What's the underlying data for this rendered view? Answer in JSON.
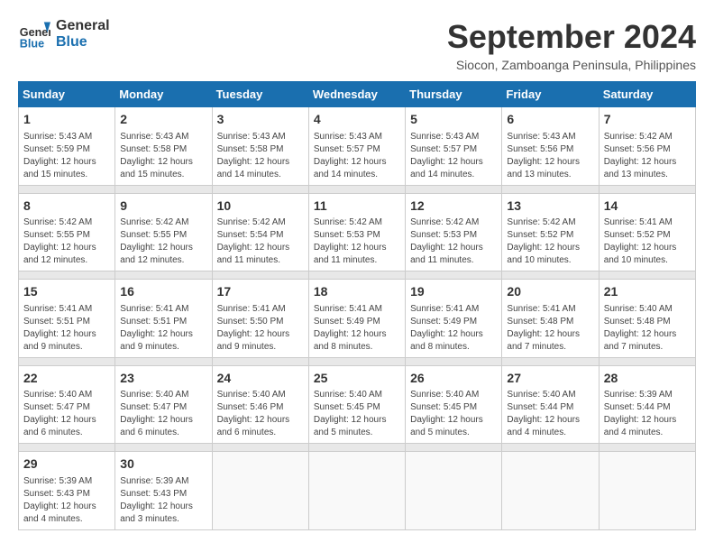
{
  "logo": {
    "text_general": "General",
    "text_blue": "Blue"
  },
  "title": {
    "month_year": "September 2024",
    "location": "Siocon, Zamboanga Peninsula, Philippines"
  },
  "weekdays": [
    "Sunday",
    "Monday",
    "Tuesday",
    "Wednesday",
    "Thursday",
    "Friday",
    "Saturday"
  ],
  "weeks": [
    [
      {
        "day": "1",
        "sunrise": "5:43 AM",
        "sunset": "5:59 PM",
        "daylight": "12 hours and 15 minutes."
      },
      {
        "day": "2",
        "sunrise": "5:43 AM",
        "sunset": "5:58 PM",
        "daylight": "12 hours and 15 minutes."
      },
      {
        "day": "3",
        "sunrise": "5:43 AM",
        "sunset": "5:58 PM",
        "daylight": "12 hours and 14 minutes."
      },
      {
        "day": "4",
        "sunrise": "5:43 AM",
        "sunset": "5:57 PM",
        "daylight": "12 hours and 14 minutes."
      },
      {
        "day": "5",
        "sunrise": "5:43 AM",
        "sunset": "5:57 PM",
        "daylight": "12 hours and 14 minutes."
      },
      {
        "day": "6",
        "sunrise": "5:43 AM",
        "sunset": "5:56 PM",
        "daylight": "12 hours and 13 minutes."
      },
      {
        "day": "7",
        "sunrise": "5:42 AM",
        "sunset": "5:56 PM",
        "daylight": "12 hours and 13 minutes."
      }
    ],
    [
      {
        "day": "8",
        "sunrise": "5:42 AM",
        "sunset": "5:55 PM",
        "daylight": "12 hours and 12 minutes."
      },
      {
        "day": "9",
        "sunrise": "5:42 AM",
        "sunset": "5:55 PM",
        "daylight": "12 hours and 12 minutes."
      },
      {
        "day": "10",
        "sunrise": "5:42 AM",
        "sunset": "5:54 PM",
        "daylight": "12 hours and 11 minutes."
      },
      {
        "day": "11",
        "sunrise": "5:42 AM",
        "sunset": "5:53 PM",
        "daylight": "12 hours and 11 minutes."
      },
      {
        "day": "12",
        "sunrise": "5:42 AM",
        "sunset": "5:53 PM",
        "daylight": "12 hours and 11 minutes."
      },
      {
        "day": "13",
        "sunrise": "5:42 AM",
        "sunset": "5:52 PM",
        "daylight": "12 hours and 10 minutes."
      },
      {
        "day": "14",
        "sunrise": "5:41 AM",
        "sunset": "5:52 PM",
        "daylight": "12 hours and 10 minutes."
      }
    ],
    [
      {
        "day": "15",
        "sunrise": "5:41 AM",
        "sunset": "5:51 PM",
        "daylight": "12 hours and 9 minutes."
      },
      {
        "day": "16",
        "sunrise": "5:41 AM",
        "sunset": "5:51 PM",
        "daylight": "12 hours and 9 minutes."
      },
      {
        "day": "17",
        "sunrise": "5:41 AM",
        "sunset": "5:50 PM",
        "daylight": "12 hours and 9 minutes."
      },
      {
        "day": "18",
        "sunrise": "5:41 AM",
        "sunset": "5:49 PM",
        "daylight": "12 hours and 8 minutes."
      },
      {
        "day": "19",
        "sunrise": "5:41 AM",
        "sunset": "5:49 PM",
        "daylight": "12 hours and 8 minutes."
      },
      {
        "day": "20",
        "sunrise": "5:41 AM",
        "sunset": "5:48 PM",
        "daylight": "12 hours and 7 minutes."
      },
      {
        "day": "21",
        "sunrise": "5:40 AM",
        "sunset": "5:48 PM",
        "daylight": "12 hours and 7 minutes."
      }
    ],
    [
      {
        "day": "22",
        "sunrise": "5:40 AM",
        "sunset": "5:47 PM",
        "daylight": "12 hours and 6 minutes."
      },
      {
        "day": "23",
        "sunrise": "5:40 AM",
        "sunset": "5:47 PM",
        "daylight": "12 hours and 6 minutes."
      },
      {
        "day": "24",
        "sunrise": "5:40 AM",
        "sunset": "5:46 PM",
        "daylight": "12 hours and 6 minutes."
      },
      {
        "day": "25",
        "sunrise": "5:40 AM",
        "sunset": "5:45 PM",
        "daylight": "12 hours and 5 minutes."
      },
      {
        "day": "26",
        "sunrise": "5:40 AM",
        "sunset": "5:45 PM",
        "daylight": "12 hours and 5 minutes."
      },
      {
        "day": "27",
        "sunrise": "5:40 AM",
        "sunset": "5:44 PM",
        "daylight": "12 hours and 4 minutes."
      },
      {
        "day": "28",
        "sunrise": "5:39 AM",
        "sunset": "5:44 PM",
        "daylight": "12 hours and 4 minutes."
      }
    ],
    [
      {
        "day": "29",
        "sunrise": "5:39 AM",
        "sunset": "5:43 PM",
        "daylight": "12 hours and 4 minutes."
      },
      {
        "day": "30",
        "sunrise": "5:39 AM",
        "sunset": "5:43 PM",
        "daylight": "12 hours and 3 minutes."
      },
      null,
      null,
      null,
      null,
      null
    ]
  ]
}
